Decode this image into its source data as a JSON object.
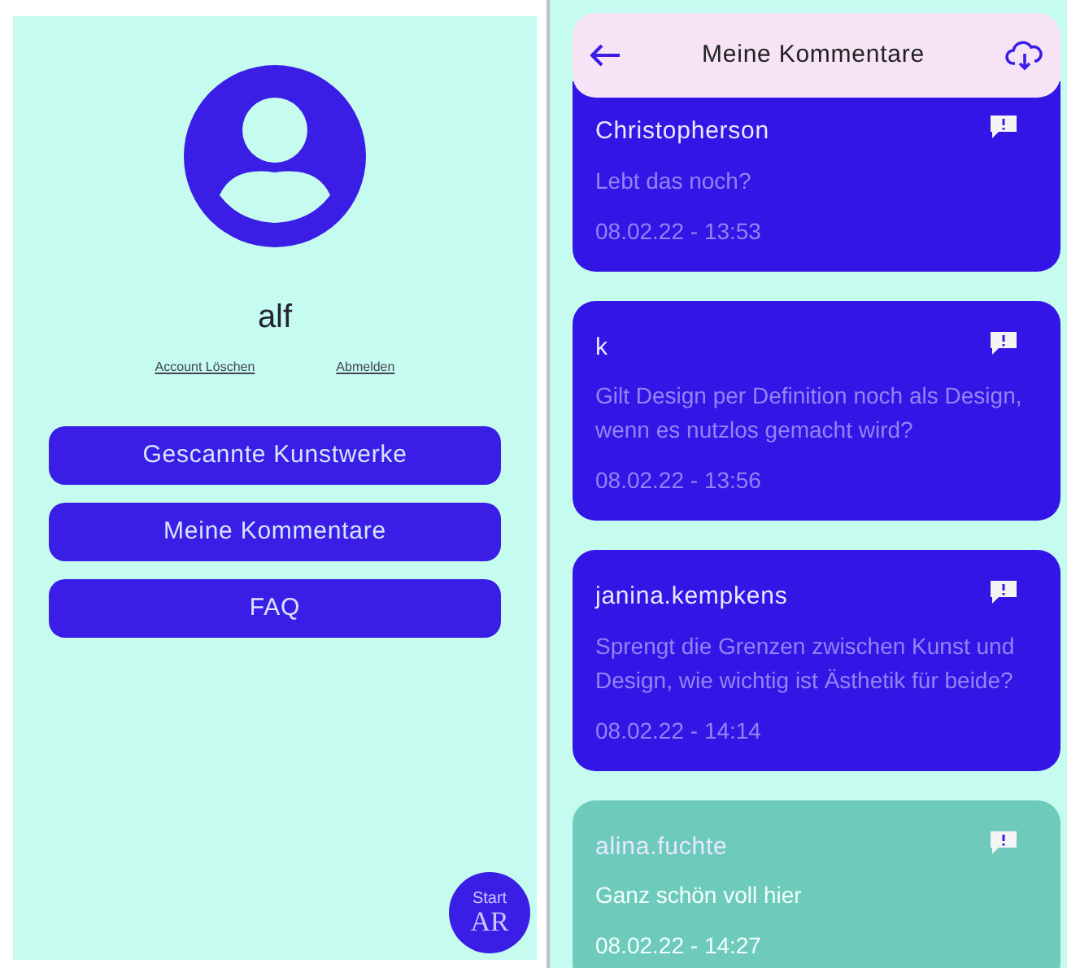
{
  "profile": {
    "username": "alf",
    "links": [
      "Account Löschen",
      "Abmelden"
    ],
    "buttons": [
      "Gescannte Kunstwerke",
      "Meine Kommentare",
      "FAQ"
    ],
    "ar_button": {
      "line_1": "Start",
      "line_2": "AR"
    }
  },
  "comments_screen": {
    "title": "Meine Kommentare",
    "comments": [
      {
        "author": "Christopherson",
        "text": "Lebt das noch?",
        "time": "08.02.22 - 13:53",
        "color": "#3316e6"
      },
      {
        "author": "k",
        "text": "Gilt Design per Definition noch als Design, wenn es nutzlos gemacht wird?",
        "time": "08.02.22 - 13:56",
        "color": "#3316e6"
      },
      {
        "author": "janina.kempkens",
        "text": "Sprengt die Grenzen zwischen Kunst und Design, wie wichtig ist Ästhetik für beide?",
        "time": "08.02.22 - 14:14",
        "color": "#3316e6"
      },
      {
        "author": "alina.fuchte",
        "text": "Ganz schön voll hier",
        "time": "08.02.22 - 14:27",
        "color": "#6ecbbb"
      }
    ]
  }
}
